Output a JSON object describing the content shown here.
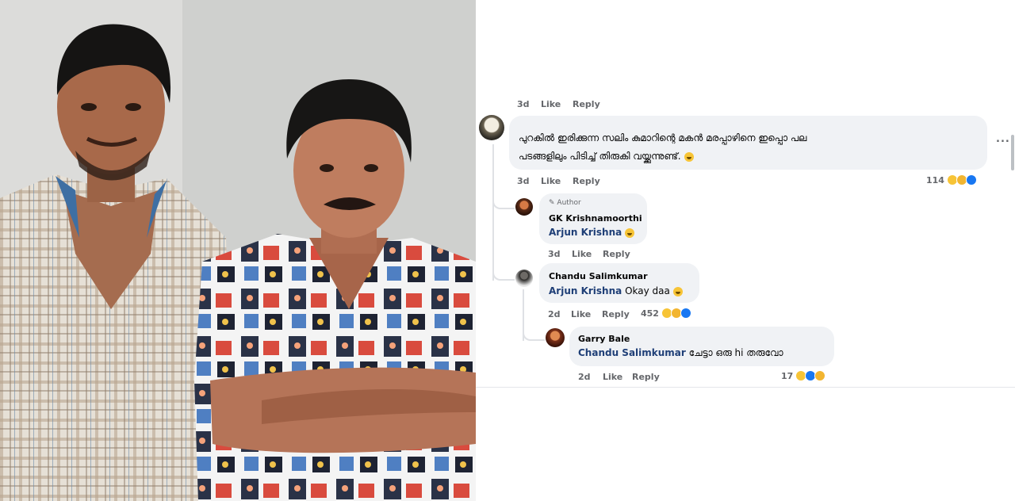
{
  "photo": {
    "description_icon": "photo-two-men"
  },
  "comments": [
    {
      "id": "top-meta",
      "time": "3d",
      "like": "Like",
      "reply": "Reply"
    },
    {
      "id": "main",
      "text_line1": "പുറകിൽ ഇരിക്കുന്ന സലിം കുമാറിന്റെ മകൻ മരപ്പാഴിനെ ഇപ്പൊ പല",
      "text_line2": "പടങ്ങളിലും പിടിച്ച് തിരുകി വയ്ക്കുന്നുണ്ട്.",
      "time": "3d",
      "like": "Like",
      "reply": "Reply",
      "reactions": "114",
      "more": "..."
    },
    {
      "id": "reply1",
      "badge": "Author",
      "name": "GK Krishnamoorthi",
      "mention": "Arjun Krishna",
      "time": "3d",
      "like": "Like",
      "reply": "Reply"
    },
    {
      "id": "reply2",
      "name": "Chandu Salimkumar",
      "mention": "Arjun Krishna",
      "text": "Okay daa",
      "time": "2d",
      "like": "Like",
      "reply": "Reply",
      "reactions": "452"
    },
    {
      "id": "reply3",
      "name": "Garry Bale",
      "mention": "Chandu Salimkumar",
      "text": "ചേട്ടാ ഒരു hi തരുവോ",
      "time": "2d",
      "like": "Like",
      "reply": "Reply",
      "reactions": "17"
    }
  ],
  "colors": {
    "bubble": "#f0f2f5",
    "mention": "#1f3f77",
    "meta": "#65676b"
  }
}
